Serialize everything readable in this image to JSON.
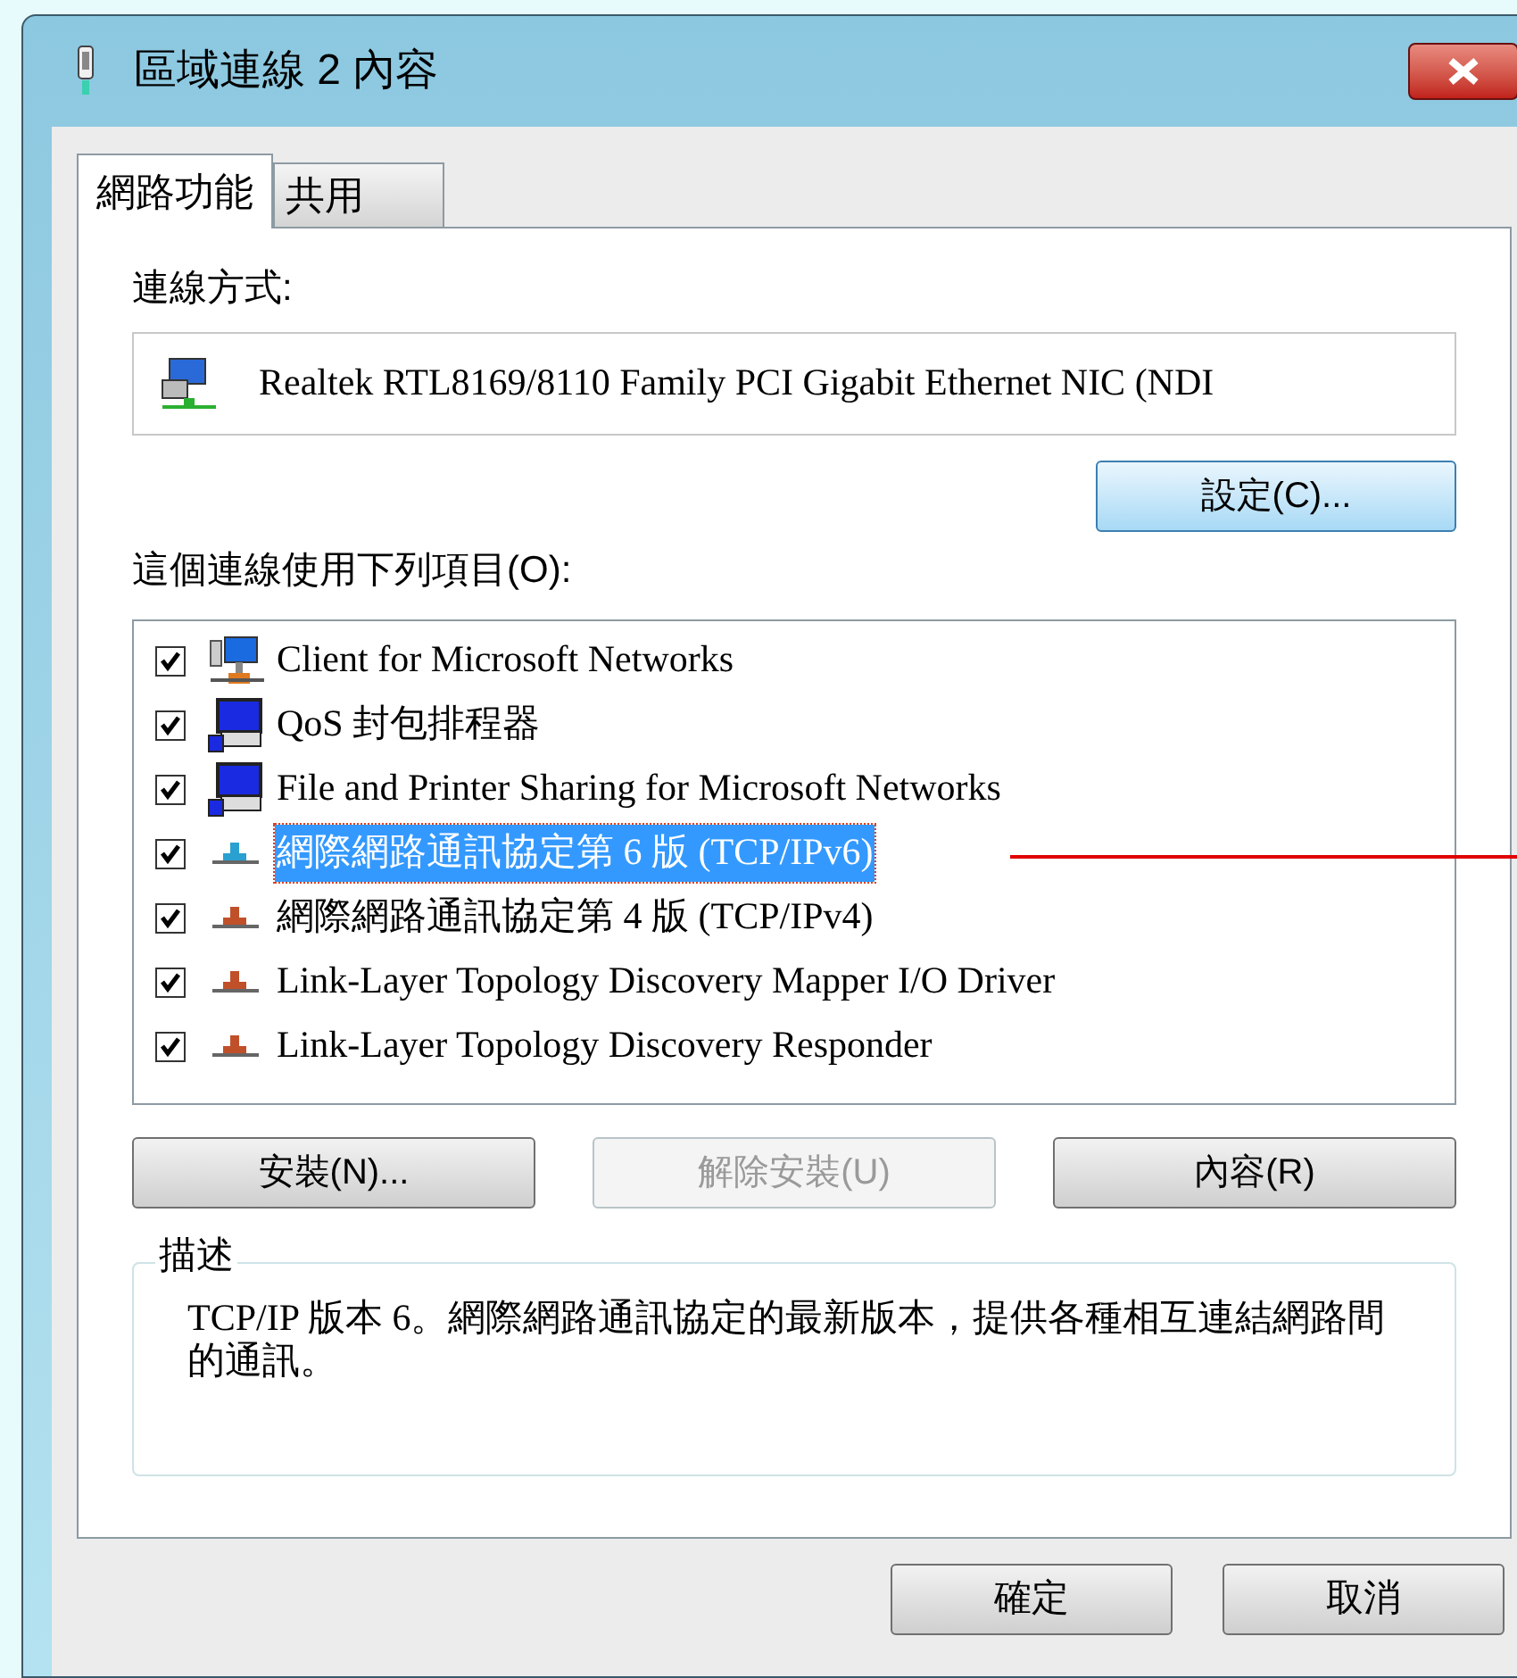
{
  "window": {
    "title": "區域連線 2 內容"
  },
  "tabs": [
    {
      "label": "網路功能",
      "selected": true
    },
    {
      "label": "共用",
      "selected": false
    }
  ],
  "connect_using": {
    "label": "連線方式:",
    "adapter": "Realtek RTL8169/8110 Family PCI Gigabit Ethernet NIC (NDI",
    "configure_button": "設定(C)..."
  },
  "items_label": "這個連線使用下列項目(O):",
  "items": [
    {
      "kind": "client",
      "label": "Client for Microsoft Networks",
      "checked": true,
      "selected": false
    },
    {
      "kind": "service",
      "label": "QoS 封包排程器",
      "checked": true,
      "selected": false
    },
    {
      "kind": "service",
      "label": "File and Printer Sharing for Microsoft Networks",
      "checked": true,
      "selected": false
    },
    {
      "kind": "protocol",
      "label": "網際網路通訊協定第 6 版 (TCP/IPv6)",
      "checked": true,
      "selected": true
    },
    {
      "kind": "protocol",
      "label": "網際網路通訊協定第 4 版 (TCP/IPv4)",
      "checked": true,
      "selected": false
    },
    {
      "kind": "protocol",
      "label": "Link-Layer Topology Discovery Mapper I/O Driver",
      "checked": true,
      "selected": false
    },
    {
      "kind": "protocol",
      "label": "Link-Layer Topology Discovery Responder",
      "checked": true,
      "selected": false
    }
  ],
  "item_buttons": [
    {
      "label": "安裝(N)...",
      "disabled": false
    },
    {
      "label": "解除安裝(U)",
      "disabled": true
    },
    {
      "label": "內容(R)",
      "disabled": false
    }
  ],
  "description": {
    "legend": "描述",
    "text": "TCP/IP 版本 6。網際網路通訊協定的最新版本，提供各種相互連結網路間的通訊。"
  },
  "dialog_buttons": [
    "確定",
    "取消"
  ]
}
